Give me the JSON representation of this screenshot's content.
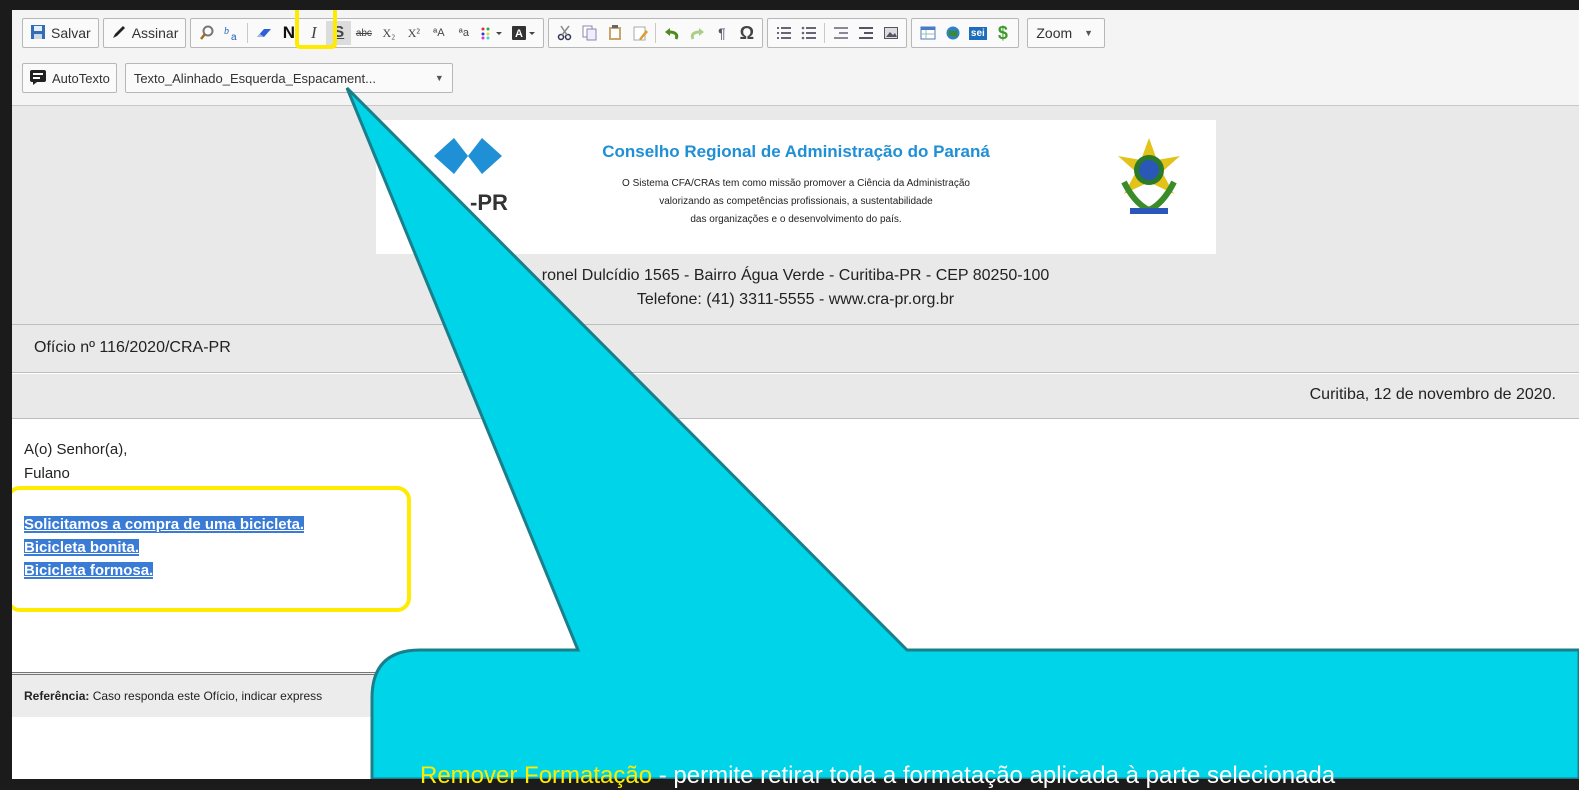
{
  "toolbar": {
    "save_label": "Salvar",
    "sign_label": "Assinar",
    "bold_label": "N",
    "italic_label": "I",
    "underline_label": "S",
    "strike_label": "abc",
    "subscript_label": "X₂",
    "superscript_label": "X²",
    "omega_label": "Ω",
    "pilcrow_label": "¶",
    "sei_label": "sei",
    "dollar_label": "$",
    "zoom_label": "Zoom",
    "autotext_label": "AutoTexto",
    "style_value": "Texto_Alinhado_Esquerda_Espacament..."
  },
  "letterhead": {
    "org_name": "Conselho Regional de Administração do Paraná",
    "mission_1": "O Sistema CFA/CRAs tem como missão promover a Ciência da Administração",
    "mission_2": "valorizando as competências profissionais, a sustentabilidade",
    "mission_3": "das organizações e o desenvolvimento do país.",
    "logo_abbr": "-PR",
    "address": "ronel Dulcídio 1565 - Bairro Água Verde - Curitiba-PR - CEP 80250-100",
    "phone": "Telefone: (41) 3311-5555 - www.cra-pr.org.br"
  },
  "document": {
    "oficio": "Ofício nº 116/2020/CRA-PR",
    "date": "Curitiba, 12 de novembro de 2020.",
    "salutation": "A(o) Senhor(a),",
    "recipient": "Fulano",
    "selected_lines": [
      "Solicitamos a compra de uma bicicleta. ",
      "Bicicleta bonita.",
      "Bicicleta formosa."
    ],
    "reference_label": "Referência:",
    "reference_text": " Caso responda este Ofício, indicar express"
  },
  "callout": {
    "highlight_word": "Remover Formatação",
    "rest_text": " - permite retirar toda a formatação aplicada à parte selecionada"
  },
  "colors": {
    "callout_fill": "#00d4e8",
    "highlight": "#ffeb00",
    "selection": "#3a7bd5",
    "brand_blue": "#1f8fd6"
  }
}
